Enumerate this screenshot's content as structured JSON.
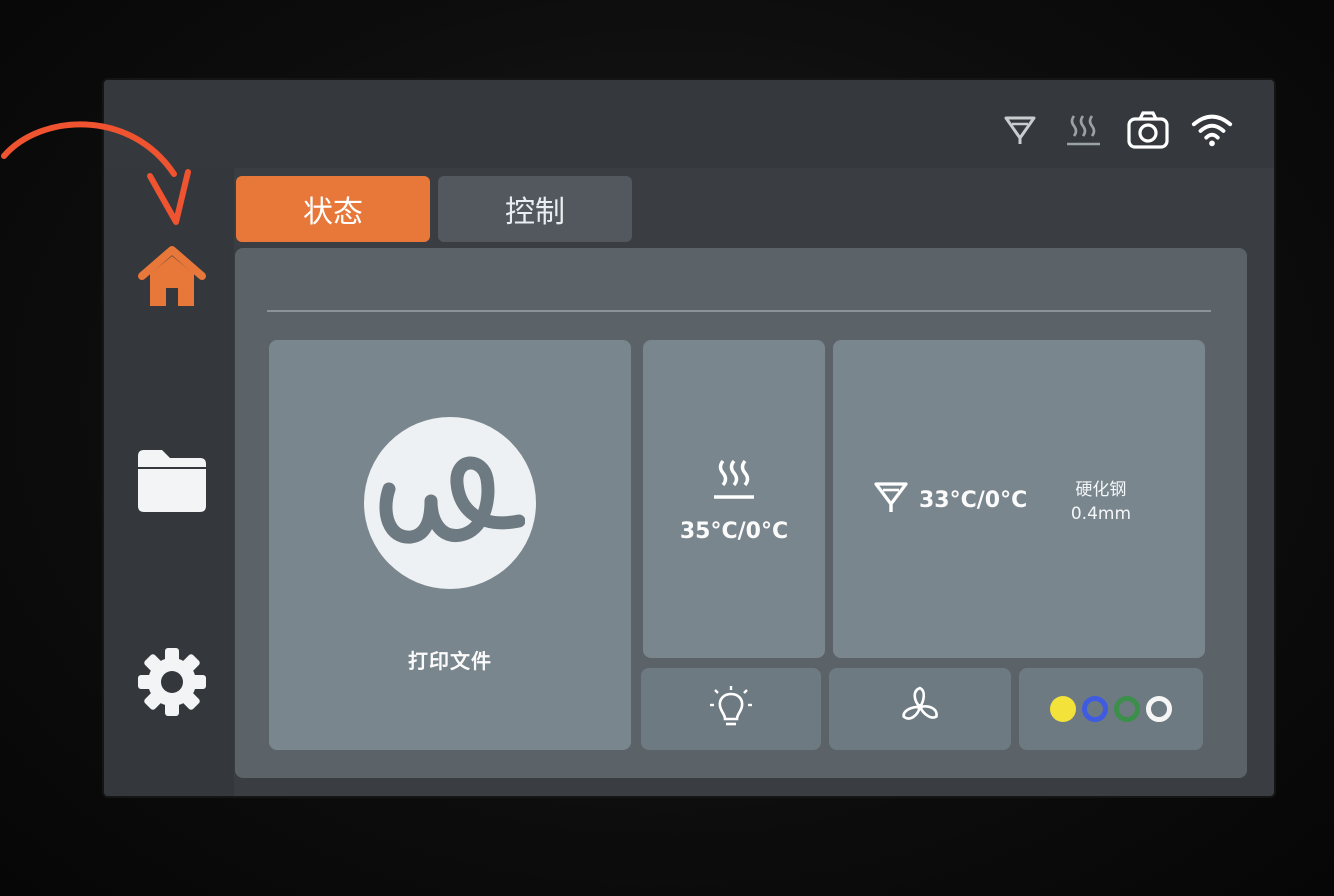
{
  "status_bar": {
    "icons": [
      "nozzle-icon",
      "heatbed-icon",
      "camera-icon",
      "wifi-icon"
    ]
  },
  "sidebar": {
    "items": [
      {
        "icon": "home-icon",
        "active": true
      },
      {
        "icon": "folder-icon",
        "active": false
      },
      {
        "icon": "gear-icon",
        "active": false
      }
    ]
  },
  "tabs": [
    {
      "label": "状态",
      "active": true
    },
    {
      "label": "控制",
      "active": false
    }
  ],
  "print_card": {
    "label": "打印文件",
    "icon": "brand-logo-icon"
  },
  "bed_card": {
    "icon": "heatbed-icon",
    "temperature": "35°C/0°C"
  },
  "nozzle_card": {
    "icon": "nozzle-icon",
    "temperature": "33°C/0°C",
    "material": "硬化钢",
    "diameter": "0.4mm"
  },
  "bottom_buttons": [
    {
      "icon": "light-bulb-icon"
    },
    {
      "icon": "fan-icon"
    },
    {
      "icon": "filament-slots-icon"
    }
  ],
  "filament_slots": [
    {
      "color": "#f2e23a"
    },
    {
      "color": "#3f5be0"
    },
    {
      "color": "#3c8f4a"
    },
    {
      "color": "#f5f5f5"
    }
  ],
  "colors": {
    "accent": "#e8773a",
    "annotation_arrow": "#f0532f"
  }
}
